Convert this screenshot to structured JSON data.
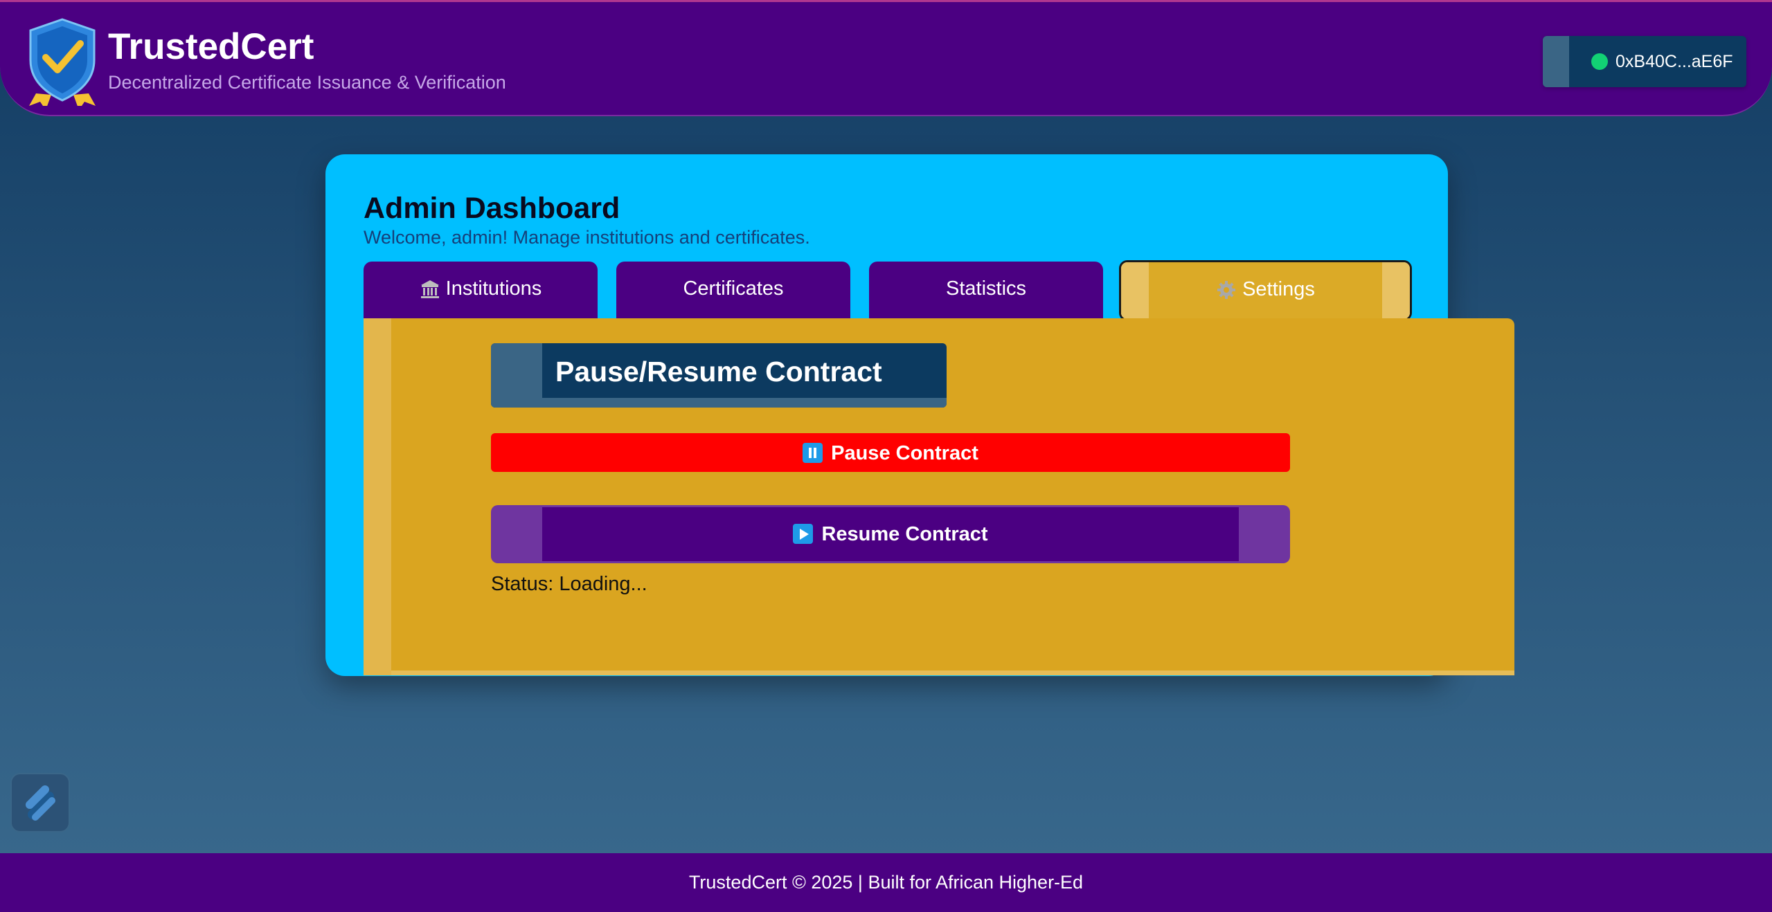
{
  "header": {
    "app_title": "TrustedCert",
    "app_subtitle": "Decentralized Certificate Issuance & Verification",
    "logo_icon": "shield-check-icon",
    "wallet": {
      "address": "0xB40C...aE6F",
      "status_color": "#12d174"
    }
  },
  "dashboard": {
    "title": "Admin Dashboard",
    "subtitle": "Welcome, admin! Manage institutions and certificates.",
    "tabs": [
      {
        "label": "Institutions",
        "icon": "bank-icon",
        "active": false
      },
      {
        "label": "Certificates",
        "icon": "",
        "active": false
      },
      {
        "label": "Statistics",
        "icon": "",
        "active": false
      },
      {
        "label": "Settings",
        "icon": "gear-icon",
        "active": true
      }
    ],
    "settings": {
      "section_title": "Pause/Resume Contract",
      "pause_label": "Pause Contract",
      "pause_icon": "pause-icon",
      "resume_label": "Resume Contract",
      "resume_icon": "play-icon",
      "status": "Status: Loading..."
    }
  },
  "footer": {
    "text": "TrustedCert © 2025 | Built for African Higher-Ed"
  },
  "colors": {
    "brand_purple": "#4b0082",
    "card_blue": "#00bfff",
    "panel_gold": "#daa520",
    "danger_red": "#ff0000",
    "icon_blue": "#1e9ae8",
    "logo_yellow": "#f5c232"
  }
}
